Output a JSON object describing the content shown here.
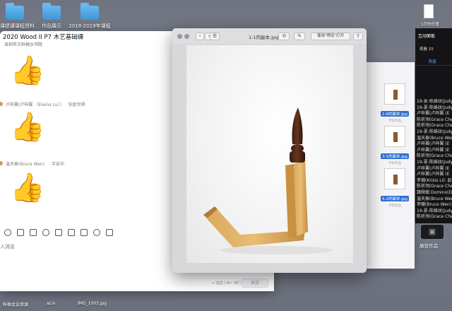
{
  "desktop": {
    "folders": [
      {
        "label": "艺课绩课课程资料"
      },
      {
        "label": "作品展示"
      },
      {
        "label": "2018-2019年课程"
      }
    ],
    "top_right_file": "1月份乐值",
    "bottom_items": [
      {
        "label": "科格会议资源"
      },
      {
        "label": "aLin"
      },
      {
        "label": "IMG_1003.jpg"
      }
    ]
  },
  "chat": {
    "title": "2020 Wood II P7 木艺基础课",
    "tag": "外部",
    "subtitle": "深圳市方科梅沙书院",
    "messages": [
      {
        "sender": "",
        "time": "",
        "content": "👍"
      },
      {
        "sender": "卢梓翼(卢梓翼 （Elaine Lu）)",
        "time": "狂欧世界",
        "content": "👍"
      },
      {
        "sender": "温天泰(Bruce Wen)",
        "time": "半安中",
        "content": "👍"
      }
    ],
    "input_placeholder": "入消息",
    "send_hint": "↵ 发送 / ⌘↵ 换行",
    "send_label": "发送"
  },
  "preview": {
    "title": "1-1的副本.jpg",
    "open_with": "使用\"预览\"打开"
  },
  "finder": {
    "items": [
      {
        "name": "1-6的副本.jpg",
        "kind": "学科作品"
      },
      {
        "name": "3-1的副本.jpg",
        "kind": "学科作品"
      },
      {
        "name": "6-2的副本.jpg",
        "kind": "学科作品"
      }
    ]
  },
  "panel": {
    "title": "互动面板",
    "watch_count": "观看 15",
    "tab": "消息",
    "names": [
      "19-夏-陈姝纹(Judy",
      "19-夏-陈姝纹(Judy",
      "卢梓翼(卢梓翼 (E",
      "陈祈翎(Grace Chen",
      "陈祈翎(Grace Chen",
      "19-夏-陈姝纹(Judy",
      "温天泰(Bruce Wen)",
      "卢梓翼(卢梓翼 (E",
      "卢梓翼(卢梓翼 (E",
      "陈祈翎(Grace Chen",
      "19-夏-陈姝纹(Judy",
      "卢梓翼(卢梓翼 (E",
      "卢梓翼(卢梓翼 (E",
      "李瀚(Krisis LI): 赵",
      "陈祈翎(Grace Chen",
      "魏舜翰 Domino(D",
      "温天泰(Bruce Wen)",
      "李骥(Bruce Wen)",
      "19-夏-陈姝纹(Judy",
      "陈祈翎(Grace Chen"
    ],
    "works_label": "展览作品"
  },
  "colors": {
    "accent": "#4a90e2",
    "panel_bg": "#141416",
    "selection": "#2f6ed1"
  }
}
